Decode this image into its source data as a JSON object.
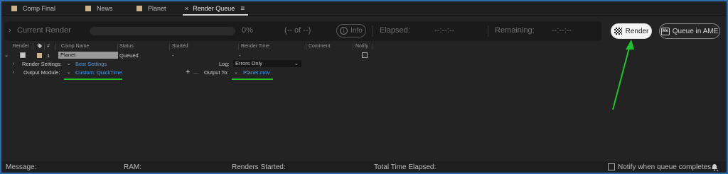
{
  "tabs": [
    {
      "label": "Comp Final"
    },
    {
      "label": "News"
    },
    {
      "label": "Planet"
    },
    {
      "label": "Render Queue",
      "close": "×",
      "menu": "≡"
    }
  ],
  "current_render": {
    "label": "Current Render",
    "percent": "0%",
    "of_count": "(-- of --)",
    "info_label": "Info",
    "elapsed_label": "Elapsed:",
    "elapsed_value": "--:--:--",
    "remaining_label": "Remaining:",
    "remaining_value": "--:--:--"
  },
  "buttons": {
    "render_label": "Render",
    "queue_label": "Queue in AME",
    "ame_icon_text": "Me"
  },
  "columns": {
    "render": "Render",
    "number": "#",
    "comp_name": "Comp Name",
    "status": "Status",
    "started": "Started",
    "render_time": "Render Time",
    "comment": "Comment",
    "notify": "Notify"
  },
  "queue_item": {
    "number": "1",
    "comp_name": "Planet",
    "status": "Queued",
    "started": "-",
    "render_time": "-"
  },
  "render_settings": {
    "label": "Render Settings:",
    "value": "Best Settings",
    "log_label": "Log:",
    "log_value": "Errors Only"
  },
  "output_module": {
    "label": "Output Module:",
    "value": "Custom: QuickTime",
    "add": "+",
    "dash": "—",
    "output_to_label": "Output To:",
    "output_to_value": "Planet.mov"
  },
  "status_bar": {
    "message": "Message:",
    "ram": "RAM:",
    "renders_started": "Renders Started:",
    "total_time": "Total Time Elapsed:",
    "notify_text": "Notify when queue completes"
  },
  "colors": {
    "annotation_green": "#22c22a",
    "link_blue": "#4a9ff0",
    "frame_blue": "#2b6cb3"
  }
}
